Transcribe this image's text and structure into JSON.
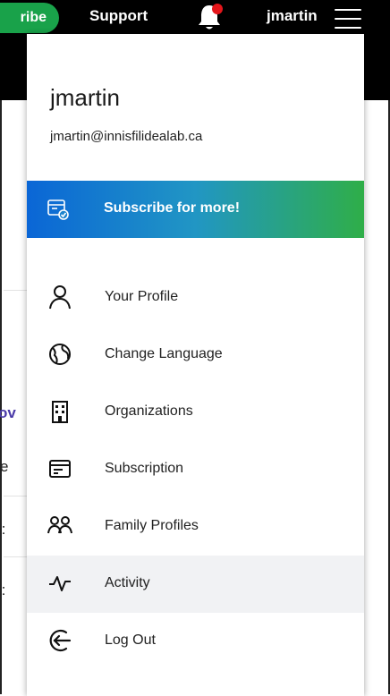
{
  "topbar": {
    "subscribe_label": "ribe",
    "support_label": "Support",
    "username": "jmartin",
    "icons": [
      "bell-icon",
      "hamburger-menu-icon"
    ],
    "colors": {
      "bar": "#000000",
      "subscribe": "#19a24a",
      "notification_dot": "#e4161b"
    }
  },
  "background": {
    "fragments": [
      "ov",
      "e",
      "):",
      "):"
    ]
  },
  "panel": {
    "name": "jmartin",
    "email": "jmartin@innisfilidealab.ca",
    "promo": {
      "label": "Subscribe for more!",
      "icon": "subscription-badge-icon",
      "gradient": [
        "#0a66d6",
        "#2fae48"
      ]
    },
    "items": [
      {
        "label": "Your Profile",
        "icon": "user-icon"
      },
      {
        "label": "Change Language",
        "icon": "globe-icon"
      },
      {
        "label": "Organizations",
        "icon": "building-icon"
      },
      {
        "label": "Subscription",
        "icon": "card-icon"
      },
      {
        "label": "Family Profiles",
        "icon": "family-icon"
      },
      {
        "label": "Activity",
        "icon": "activity-icon",
        "active": true
      },
      {
        "label": "Log Out",
        "icon": "logout-icon"
      }
    ]
  }
}
